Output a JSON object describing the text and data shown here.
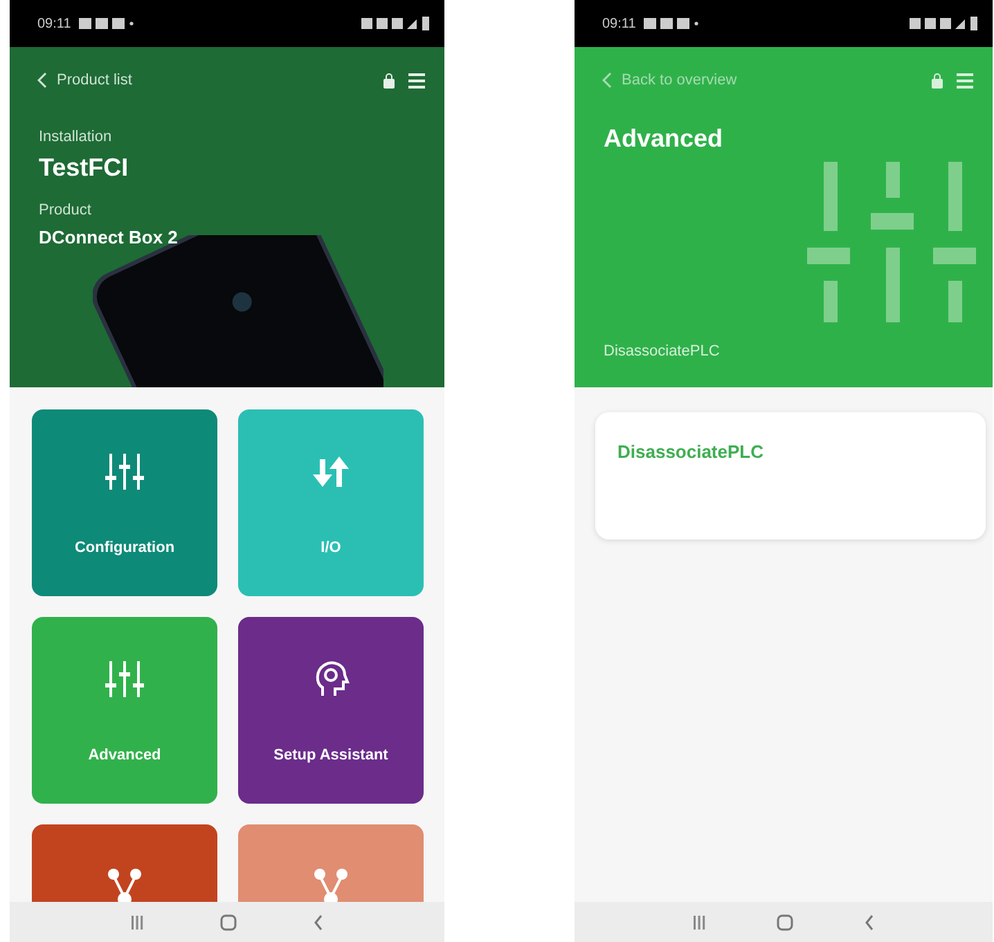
{
  "left_screen": {
    "status_bar": {
      "time": "09:11"
    },
    "header": {
      "back_label": "Product list",
      "installation_label": "Installation",
      "installation": "TestFCI",
      "product_label": "Product",
      "product": "DConnect Box 2"
    },
    "tiles": [
      {
        "label": "Configuration",
        "kind": "sliders",
        "color": "#0e8a78"
      },
      {
        "label": "I/O",
        "kind": "arrows",
        "color": "#2bbfb3"
      },
      {
        "label": "Advanced",
        "kind": "sliders",
        "color": "#31b14b"
      },
      {
        "label": "Setup Assistant",
        "kind": "head",
        "color": "#6b2c8a"
      },
      {
        "kind": "network",
        "color": "#c2441f"
      },
      {
        "kind": "network",
        "color": "#e08d72"
      }
    ]
  },
  "right_screen": {
    "status_bar": {
      "time": "09:11"
    },
    "header": {
      "back_label": "Back to overview",
      "title": "Advanced",
      "subtitle": "DisassociatePLC"
    },
    "card": {
      "title": "DisassociatePLC"
    }
  }
}
